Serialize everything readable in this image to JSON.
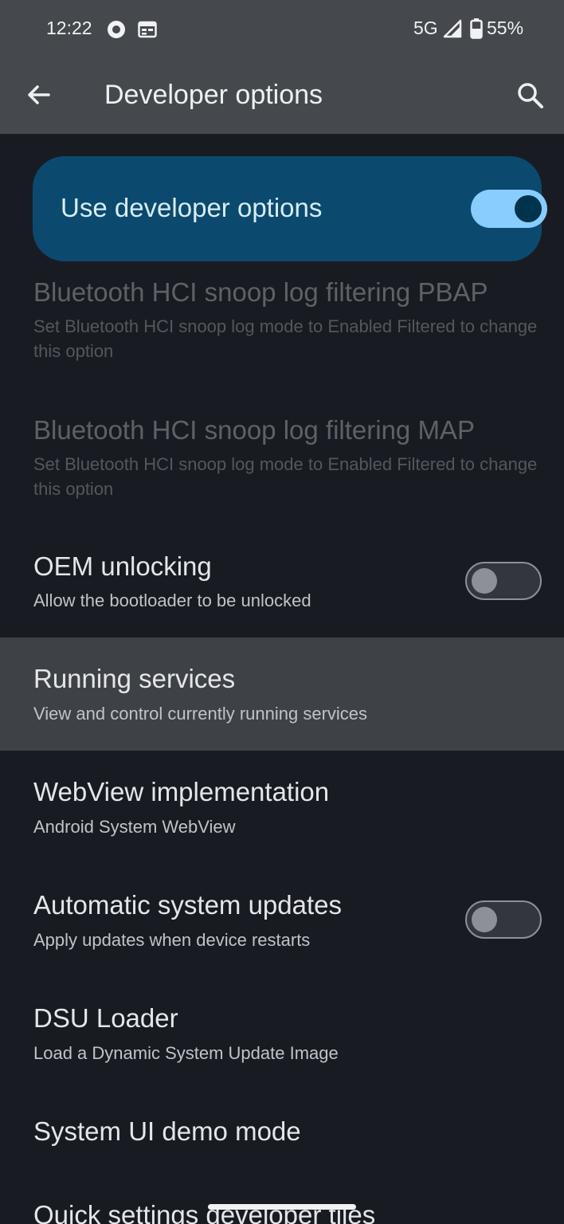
{
  "status_bar": {
    "time": "12:22",
    "network": "5G",
    "battery": "55%"
  },
  "app_bar": {
    "title": "Developer options",
    "back_icon": "arrow-back-icon",
    "search_icon": "search-icon"
  },
  "master_switch": {
    "label": "Use developer options",
    "checked": true
  },
  "items": [
    {
      "title": "Bluetooth HCI snoop log filtering PBAP",
      "subtitle": "Set Bluetooth HCI snoop log mode to Enabled Filtered to change this option",
      "enabled": false
    },
    {
      "title": "Bluetooth HCI snoop log filtering MAP",
      "subtitle": "Set Bluetooth HCI snoop log mode to Enabled Filtered to change this option",
      "enabled": false
    },
    {
      "title": "OEM unlocking",
      "subtitle": "Allow the bootloader to be unlocked",
      "switch_checked": false
    },
    {
      "title": "Running services",
      "subtitle": "View and control currently running services"
    },
    {
      "title": "WebView implementation",
      "subtitle": "Android System WebView"
    },
    {
      "title": "Automatic system updates",
      "subtitle": "Apply updates when device restarts",
      "switch_checked": false
    },
    {
      "title": "DSU Loader",
      "subtitle": "Load a Dynamic System Update Image"
    },
    {
      "title": "System UI demo mode"
    },
    {
      "title": "Quick settings developer tiles"
    }
  ],
  "colors": {
    "background": "#181c22",
    "app_bar": "#45484d",
    "master_card": "#0b4a6e",
    "switch_on_track": "#88cdfd",
    "switch_on_thumb": "#00344e",
    "highlight_row": "#3e4146"
  }
}
